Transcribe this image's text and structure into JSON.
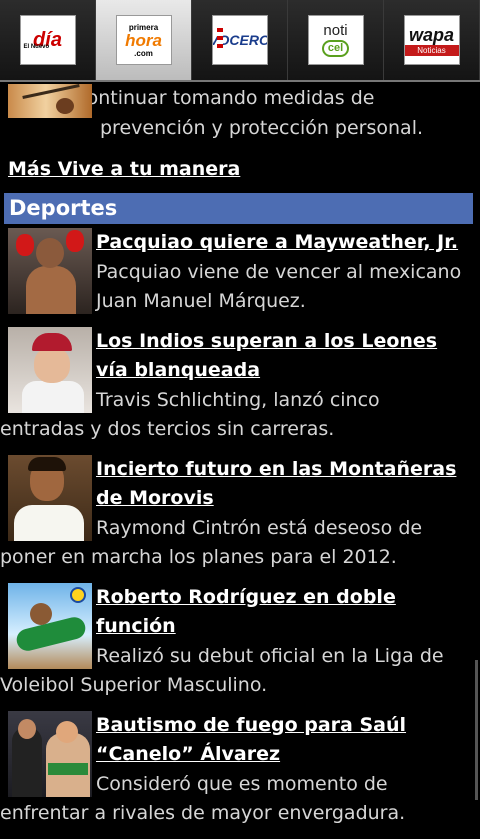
{
  "tabs": [
    {
      "name": "El Nuevo Día",
      "logo_text": "día",
      "logo_sub": "El Nuevo",
      "active": false
    },
    {
      "name": "Primera Hora",
      "logo_top": "primera",
      "logo_mid": "hora",
      "logo_bot": ".com",
      "active": true
    },
    {
      "name": "El Vocero",
      "logo_text": "VOCERO",
      "active": false
    },
    {
      "name": "Noticel",
      "logo_a": "noti",
      "logo_b": "cel",
      "active": false
    },
    {
      "name": "Wapa Noticias",
      "logo_a": "wapa",
      "logo_b": "Noticias",
      "active": false
    }
  ],
  "intro_text": "Deben continuar tomando medidas de prevención y protección personal.",
  "more_link": "Más Vive a tu manera",
  "section_title": "Deportes",
  "articles": [
    {
      "headline": "Pacquiao quiere a Mayweather, Jr.",
      "summary": "Pacquiao viene de vencer al mexicano Juan Manuel Márquez."
    },
    {
      "headline": "Los Indios superan a los Leones vía blanqueada",
      "summary": "Travis Schlichting, lanzó cinco entradas y dos tercios sin carreras."
    },
    {
      "headline": "Incierto futuro en las Montañeras de Morovis",
      "summary": "Raymond Cintrón está deseoso de poner en marcha los planes para el 2012."
    },
    {
      "headline": "Roberto Rodríguez en doble función",
      "summary": "Realizó su debut oficial en la Liga de Voleibol Superior Masculino."
    },
    {
      "headline": "Bautismo de fuego para Saúl “Canelo” Álvarez",
      "summary": "Consideró que es momento de enfrentar a rivales de mayor envergadura."
    }
  ],
  "colors": {
    "section_header": "#4d6db3",
    "background": "#000000",
    "tab_active": "#d9d9d9"
  }
}
